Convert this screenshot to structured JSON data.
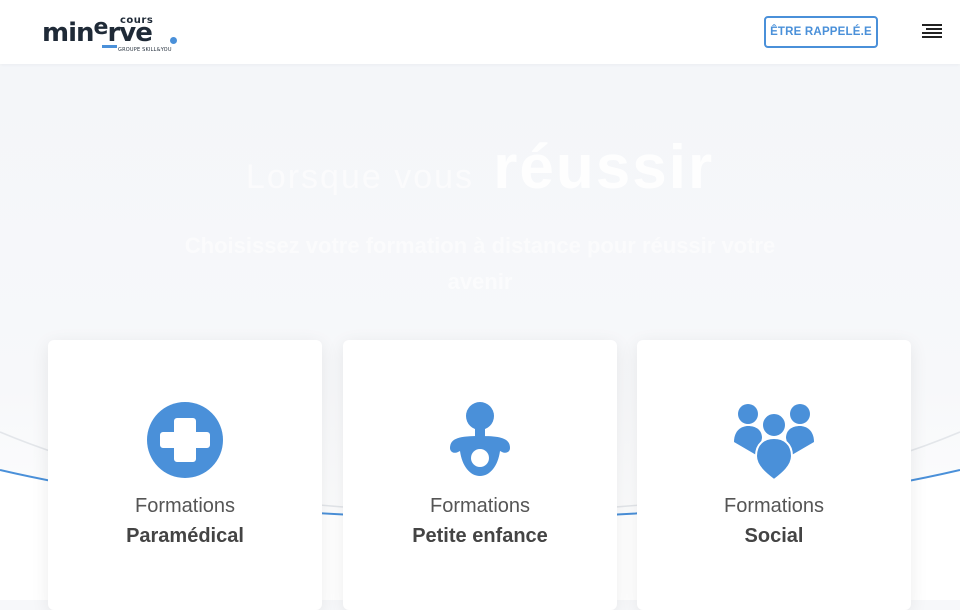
{
  "header": {
    "logo": {
      "main": "minerve",
      "top": "cours",
      "sub": "GROUPE SKILL&YOU"
    },
    "callback_label": "ÊTRE RAPPELÉ.E",
    "menu_icon": "hamburger-icon"
  },
  "hero": {
    "title_prefix": "Lorsque vous",
    "title_main": "réussir",
    "subtitle": "Choisissez votre formation à distance pour réussir votre avenir"
  },
  "cards": [
    {
      "icon": "medical-cross-icon",
      "line1": "Formations",
      "line2": "Paramédical"
    },
    {
      "icon": "pacifier-icon",
      "line1": "Formations",
      "line2": "Petite enfance"
    },
    {
      "icon": "people-group-icon",
      "line1": "Formations",
      "line2": "Social"
    }
  ],
  "colors": {
    "accent": "#4a90d9",
    "text_dark": "#1f2a37"
  }
}
